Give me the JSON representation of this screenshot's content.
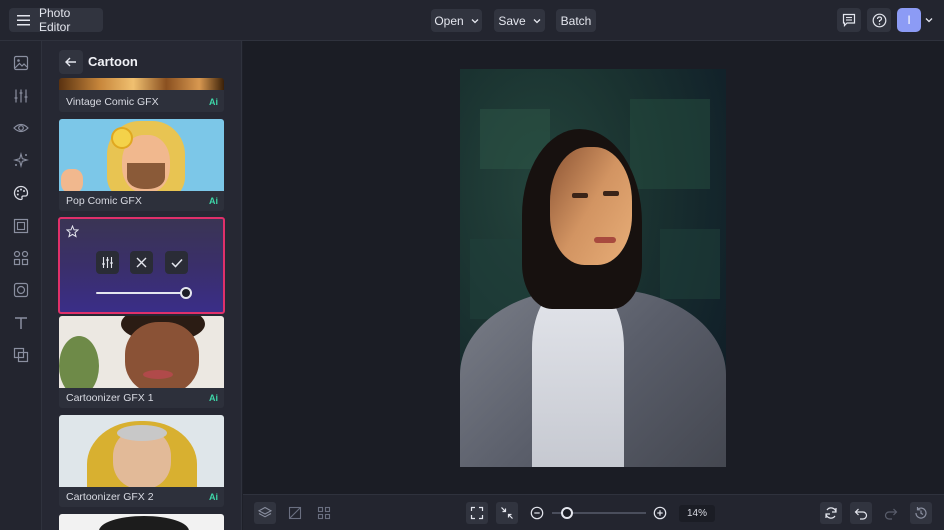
{
  "header": {
    "app_title": "Photo Editor",
    "menu": {
      "open_label": "Open",
      "save_label": "Save",
      "batch_label": "Batch"
    },
    "avatar_initial": "I"
  },
  "rail": {
    "icons": [
      "image-icon",
      "adjustments-icon",
      "eye-icon",
      "sparkle-icon",
      "palette-icon",
      "frame-icon",
      "grid-icon",
      "overlay-icon",
      "text-icon",
      "layers-graphic-icon"
    ]
  },
  "panel": {
    "title": "Cartoon",
    "cards": [
      {
        "label": "Vintage Comic GFX",
        "badge": "Ai"
      },
      {
        "label": "Pop Comic GFX",
        "badge": "Ai"
      },
      {
        "label": "Cartoonizer GFX 1",
        "badge": "Ai"
      },
      {
        "label": "Cartoonizer GFX 2",
        "badge": "Ai"
      }
    ],
    "active_card": {
      "intensity": 1.0
    }
  },
  "footer": {
    "zoom_label": "14%",
    "zoom_level": 0.14
  },
  "colors": {
    "accent": "#e0306a",
    "avatar": "#8c9bf5",
    "ai_badge": "#3ed6a8"
  }
}
